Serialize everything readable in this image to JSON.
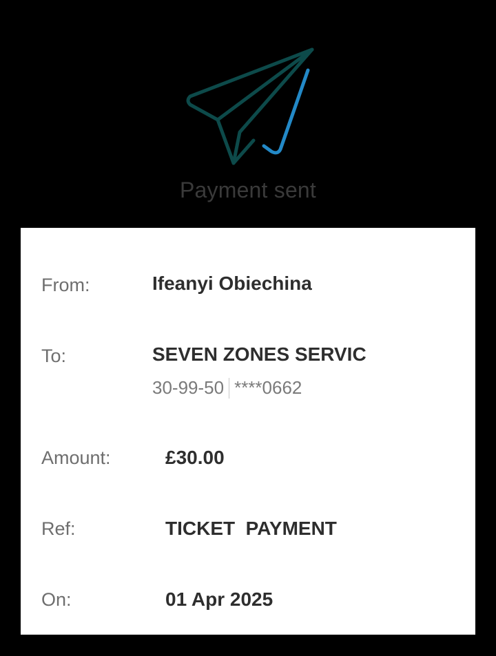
{
  "header": {
    "title": "Payment sent",
    "icon": "paper-plane-icon",
    "colors": {
      "plane": "#0d4a4a",
      "check": "#2389c7"
    }
  },
  "details": {
    "from": {
      "label": "From:",
      "value": "Ifeanyi Obiechina"
    },
    "to": {
      "label": "To:",
      "value": "SEVEN ZONES SERVIC",
      "sort_code": "30-99-50",
      "account": "****0662"
    },
    "amount": {
      "label": "Amount:",
      "value": "£30.00"
    },
    "ref": {
      "label": "Ref:",
      "value": "TICKET  PAYMENT"
    },
    "on": {
      "label": "On:",
      "value": "01 Apr 2025"
    }
  }
}
